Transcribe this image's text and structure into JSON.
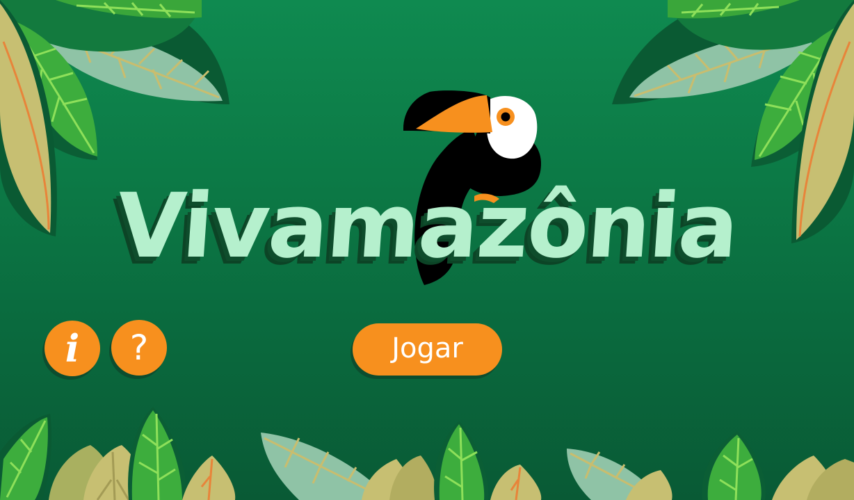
{
  "game": {
    "title": "Vivamazônia",
    "play_label": "Jogar",
    "info_label": "i",
    "help_label": "?"
  },
  "colors": {
    "background": "#0c7a46",
    "title": "#b5f0cd",
    "button": "#f7901e",
    "leaf_green": "#3cae3c",
    "leaf_khaki": "#c7bf72",
    "leaf_mint": "#8cc4a0"
  },
  "icons": {
    "info": "info-icon",
    "help": "help-icon",
    "mascot": "toucan-icon"
  }
}
